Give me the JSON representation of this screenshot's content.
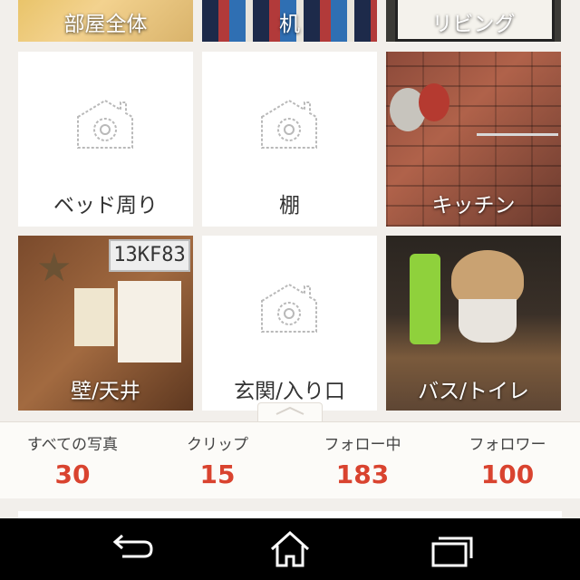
{
  "tiles": [
    {
      "label": "部屋全体",
      "type": "photo"
    },
    {
      "label": "机",
      "type": "photo"
    },
    {
      "label": "リビング",
      "type": "photo"
    },
    {
      "label": "ベッド周り",
      "type": "placeholder",
      "icon": "camera-house-icon"
    },
    {
      "label": "棚",
      "type": "placeholder",
      "icon": "camera-house-icon"
    },
    {
      "label": "キッチン",
      "type": "photo"
    },
    {
      "label": "壁/天井",
      "type": "photo",
      "plate_text": "13KF83"
    },
    {
      "label": "玄関/入り口",
      "type": "placeholder",
      "icon": "camera-house-icon"
    },
    {
      "label": "バス/トイレ",
      "type": "photo"
    }
  ],
  "stats": [
    {
      "label": "すべての写真",
      "value": "30"
    },
    {
      "label": "クリップ",
      "value": "15"
    },
    {
      "label": "フォロー中",
      "value": "183"
    },
    {
      "label": "フォロワー",
      "value": "100"
    }
  ],
  "nav": {
    "back_icon": "back-icon",
    "home_icon": "home-icon",
    "recents_icon": "recent-apps-icon"
  },
  "colors": {
    "stat_value": "#d9432f",
    "background": "#f2efeb",
    "navbar": "#000000"
  }
}
